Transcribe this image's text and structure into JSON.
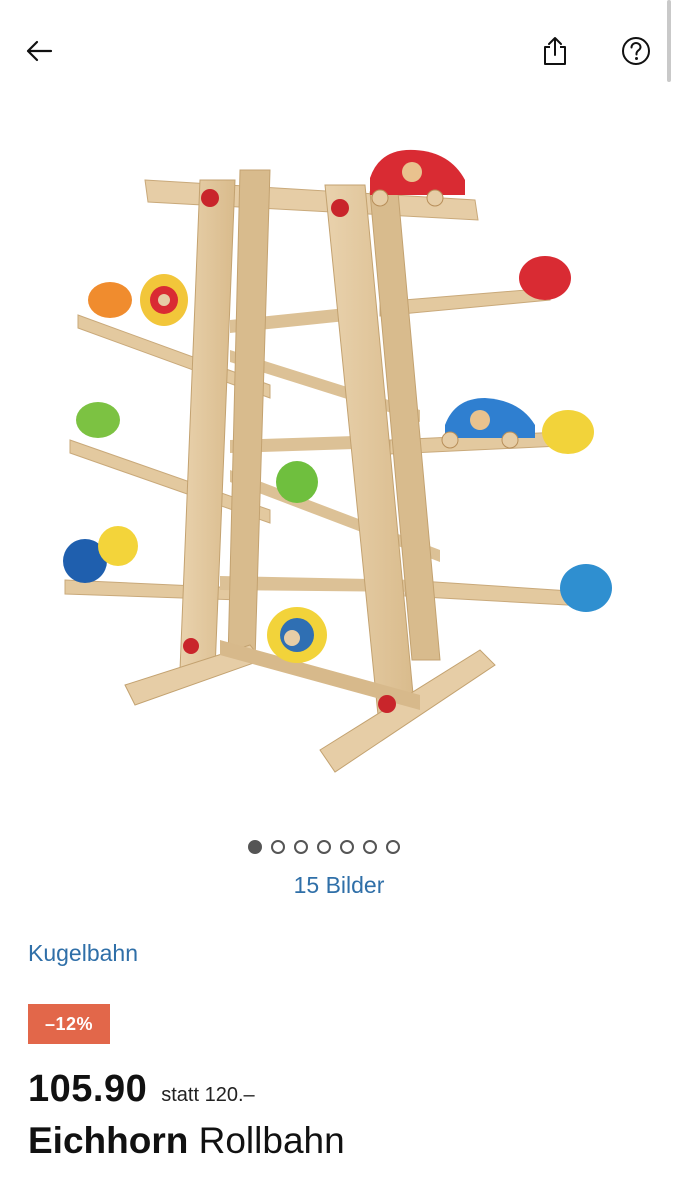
{
  "topbar": {
    "back_icon": "arrow-left-icon",
    "share_icon": "share-icon",
    "help_icon": "question-circle-icon"
  },
  "gallery": {
    "image_subject": "wooden marble run toy",
    "total_dots": 7,
    "active_index": 0,
    "image_count_label": "15 Bilder"
  },
  "product": {
    "category": "Kugelbahn",
    "discount_badge": "–12%",
    "price": "105.90",
    "old_price_label": "statt 120.–",
    "brand": "Eichhorn",
    "name": "Rollbahn"
  },
  "colors": {
    "link": "#2f6fa8",
    "badge_bg": "#e2674a",
    "text": "#111111"
  }
}
